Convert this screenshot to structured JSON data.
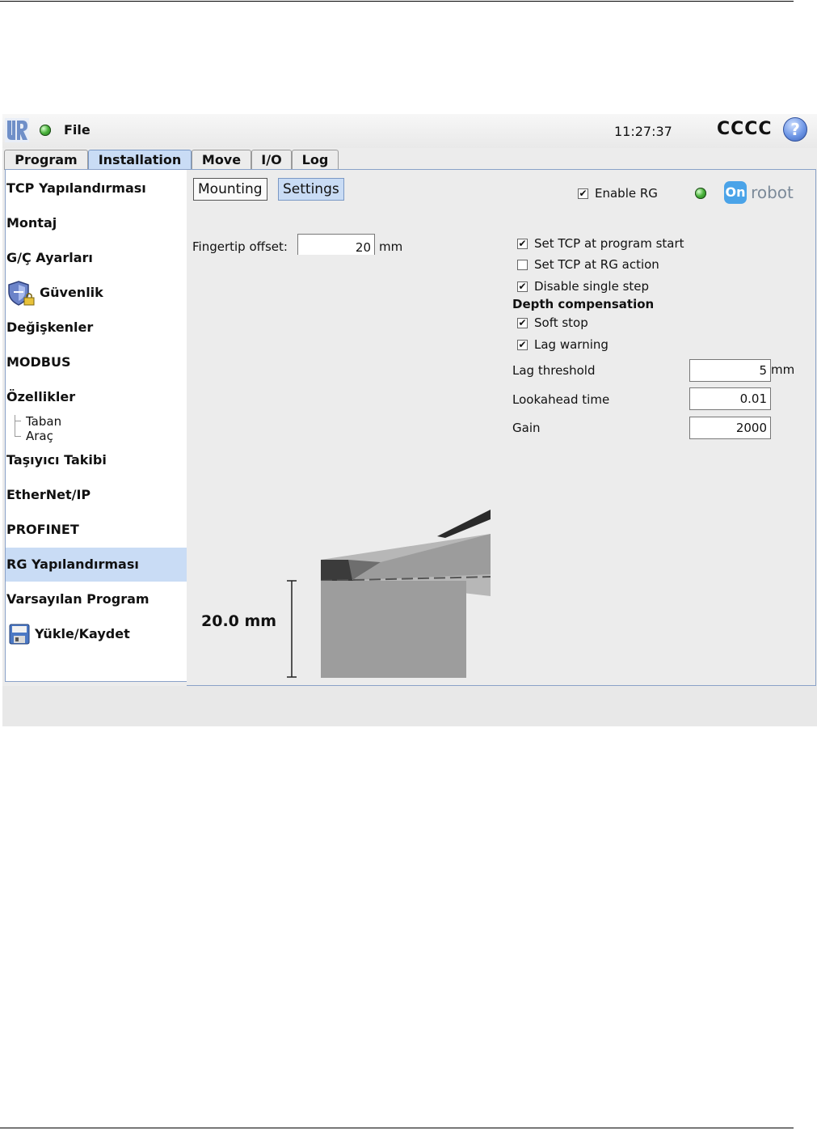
{
  "app": {
    "menu_label": "File",
    "clock": "11:27:37",
    "robot_name": "CCCC",
    "help_glyph": "?",
    "status_color": "#3fa83a"
  },
  "tabs": [
    {
      "label": "Program",
      "active": false
    },
    {
      "label": "Installation",
      "active": true
    },
    {
      "label": "Move",
      "active": false
    },
    {
      "label": "I/O",
      "active": false
    },
    {
      "label": "Log",
      "active": false
    }
  ],
  "sidebar": {
    "items": [
      {
        "label": "TCP Yapılandırması"
      },
      {
        "label": "Montaj"
      },
      {
        "label": "G/Ç Ayarları"
      },
      {
        "label": "Güvenlik",
        "icon": "shield-lock-icon"
      },
      {
        "label": "Değişkenler"
      },
      {
        "label": "MODBUS"
      },
      {
        "label": "Özellikler"
      },
      {
        "label": "Taban"
      },
      {
        "label": "Araç"
      },
      {
        "label": "Taşıyıcı Takibi"
      },
      {
        "label": "EtherNet/IP"
      },
      {
        "label": "PROFINET"
      },
      {
        "label": "RG Yapılandırması",
        "active": true
      },
      {
        "label": "Varsayılan Program"
      },
      {
        "label": "Yükle/Kaydet",
        "icon": "floppy-disk-icon"
      }
    ]
  },
  "rg": {
    "mounting_label": "Mounting",
    "settings_label": "Settings",
    "enable_rg_label": "Enable RG",
    "enable_rg_checked": true,
    "brand": {
      "on": "On",
      "robot": "robot"
    },
    "fingertip_label": "Fingertip offset:",
    "fingertip_value": "20",
    "fingertip_unit": "mm",
    "options": [
      {
        "label": "Set TCP at program start",
        "checked": true
      },
      {
        "label": "Set TCP at RG action",
        "checked": false
      },
      {
        "label": "Disable single step",
        "checked": true
      }
    ],
    "depth_heading": "Depth compensation",
    "depth_options": [
      {
        "label": "Soft stop",
        "checked": true
      },
      {
        "label": "Lag warning",
        "checked": true
      }
    ],
    "lag_threshold_label": "Lag threshold",
    "lag_threshold_value": "5",
    "lag_threshold_unit": "mm",
    "lookahead_label": "Lookahead time",
    "lookahead_value": "0.01",
    "gain_label": "Gain",
    "gain_value": "2000",
    "preview_dimension": "20.0 mm",
    "check_glyph": "✔"
  }
}
